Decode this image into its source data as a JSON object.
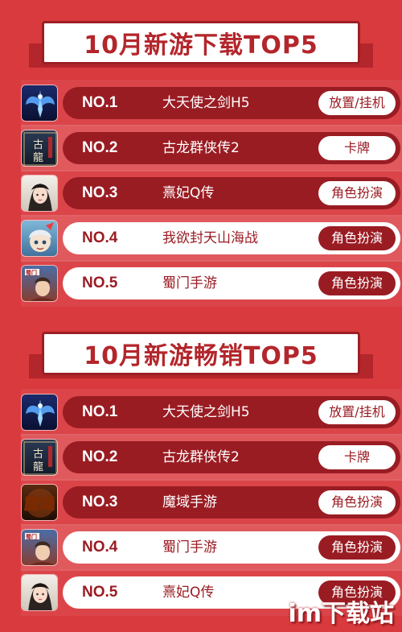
{
  "colors": {
    "background": "#d93a3e",
    "dark_pill": "#9a1c23",
    "light_pill": "#ffffff",
    "title_text": "#b3262b"
  },
  "downloads": {
    "title": "10月新游下载TOP5",
    "rows": [
      {
        "rank": "NO.1",
        "name": "大天使之剑H5",
        "tag": "放置/挂机",
        "icon": "angel-sword-icon"
      },
      {
        "rank": "NO.2",
        "name": "古龙群侠传2",
        "tag": "卡牌",
        "icon": "gulong-icon"
      },
      {
        "rank": "NO.3",
        "name": "熹妃Q传",
        "tag": "角色扮演",
        "icon": "xifei-icon"
      },
      {
        "rank": "NO.4",
        "name": "我欲封天山海战",
        "tag": "角色扮演",
        "icon": "fengtian-icon"
      },
      {
        "rank": "NO.5",
        "name": "蜀门手游",
        "tag": "角色扮演",
        "icon": "shumen-icon"
      }
    ]
  },
  "sales": {
    "title": "10月新游畅销TOP5",
    "rows": [
      {
        "rank": "NO.1",
        "name": "大天使之剑H5",
        "tag": "放置/挂机",
        "icon": "angel-sword-icon"
      },
      {
        "rank": "NO.2",
        "name": "古龙群侠传2",
        "tag": "卡牌",
        "icon": "gulong-icon"
      },
      {
        "rank": "NO.3",
        "name": "魔域手游",
        "tag": "角色扮演",
        "icon": "moyu-icon"
      },
      {
        "rank": "NO.4",
        "name": "蜀门手游",
        "tag": "角色扮演",
        "icon": "shumen-icon"
      },
      {
        "rank": "NO.5",
        "name": "熹妃Q传",
        "tag": "角色扮演",
        "icon": "xifei-icon"
      }
    ]
  },
  "watermark": "im下载站"
}
